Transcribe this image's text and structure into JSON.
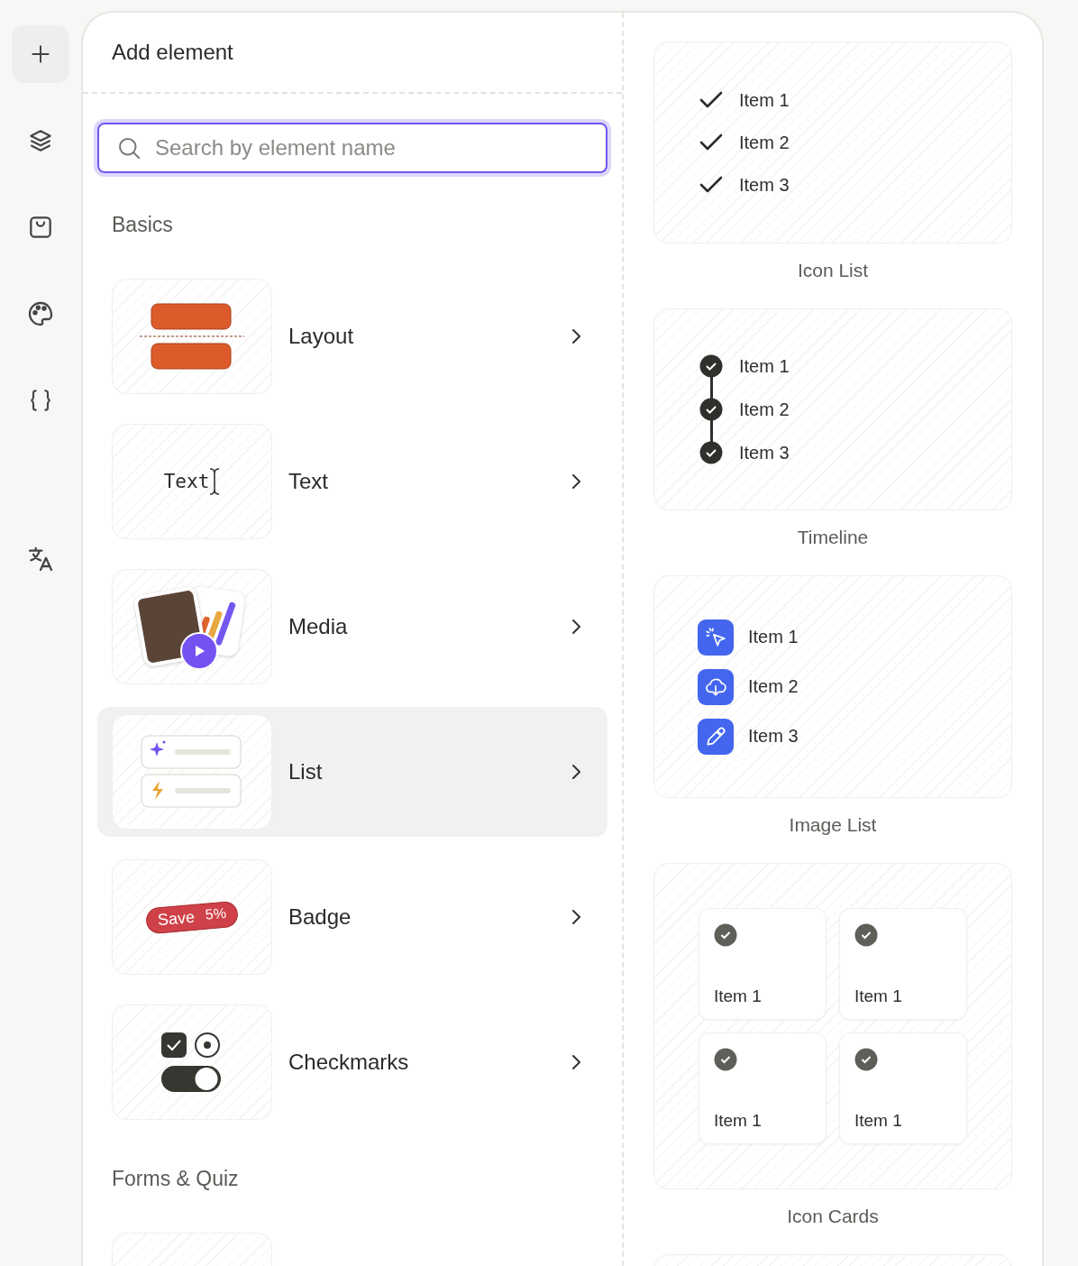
{
  "rail": {
    "items": [
      {
        "kind": "add"
      },
      {
        "kind": "layers"
      },
      {
        "kind": "tray"
      },
      {
        "kind": "palette"
      },
      {
        "kind": "braces"
      },
      {
        "kind": "translate"
      }
    ]
  },
  "panel": {
    "title": "Add element",
    "search": {
      "placeholder": "Search by element name"
    },
    "sections": [
      {
        "title": "Basics",
        "items": [
          {
            "kind": "layout",
            "label": "Layout",
            "selected": false
          },
          {
            "kind": "text",
            "label": "Text",
            "preview_text": "Text",
            "selected": false
          },
          {
            "kind": "media",
            "label": "Media",
            "selected": false
          },
          {
            "kind": "list",
            "label": "List",
            "selected": true
          },
          {
            "kind": "badge",
            "label": "Badge",
            "preview_text": "Save",
            "preview_value": "5%",
            "selected": false
          },
          {
            "kind": "checkmarks",
            "label": "Checkmarks",
            "selected": false
          }
        ]
      },
      {
        "title": "Forms & Quiz",
        "items": [
          {
            "kind": "form",
            "selected": false
          }
        ]
      }
    ]
  },
  "previews": [
    {
      "kind": "icon_list",
      "caption": "Icon List",
      "items": [
        "Item 1",
        "Item 2",
        "Item 3"
      ]
    },
    {
      "kind": "timeline",
      "caption": "Timeline",
      "items": [
        "Item 1",
        "Item 2",
        "Item 3"
      ]
    },
    {
      "kind": "image_list",
      "caption": "Image List",
      "items": [
        "Item 1",
        "Item 2",
        "Item 3"
      ]
    },
    {
      "kind": "icon_cards",
      "caption": "Icon Cards",
      "items": [
        "Item 1",
        "Item 1",
        "Item 1",
        "Item 1"
      ]
    },
    {
      "kind": "blank"
    }
  ]
}
